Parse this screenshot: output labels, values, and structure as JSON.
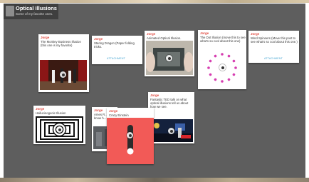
{
  "board": {
    "title": "Optical Illusions",
    "subtitle": "Some of my favorite ones."
  },
  "cards": [
    {
      "author": "Jorge",
      "text": "The Monkey Business Illusion (this one is my favorite)"
    },
    {
      "author": "Jorge",
      "text": "Staring Dragon (Paper folding tricks.",
      "attach": "ATTACHMENT"
    },
    {
      "author": "Jorge",
      "text": "Animated Optical Illusion."
    },
    {
      "author": "Jorge",
      "text": "The Dot Illusion (move this to see what's so cool about this one)"
    },
    {
      "author": "Jorge",
      "text": "Wind Spinners (Move this post to see what's so cool about this one.)",
      "attach": "ATTACHMENT"
    },
    {
      "author": "Jorge",
      "text": "Hallucinogenic Illusion"
    },
    {
      "author": "Jorge",
      "text": "Ames R... know h..."
    },
    {
      "author": "Jorge",
      "text": "Crazy Einstein"
    },
    {
      "author": "Jorge",
      "text": "Fantastic TED talk on what optical illusions tell us about how we see."
    }
  ],
  "colors": {
    "wall": "#5e5e5e",
    "header": "#3f3f3f",
    "author": "#e0483e",
    "attachment": "#3fa3d1",
    "einstein": "#f25a57"
  }
}
